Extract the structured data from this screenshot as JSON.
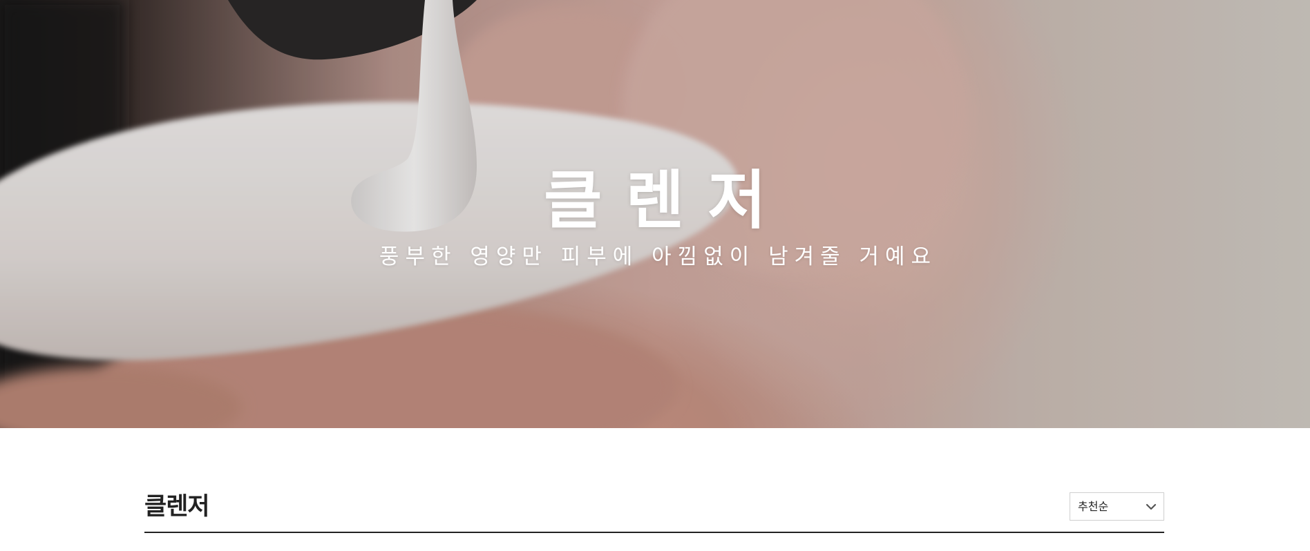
{
  "hero": {
    "title": "클렌저",
    "subtitle": "풍부한 영양만 피부에 아낌없이 남겨줄 거예요"
  },
  "category": {
    "title": "클렌저",
    "sort": {
      "selected": "추천순"
    }
  },
  "icons": {
    "sort_chevron": "chevron-down-icon"
  },
  "colors": {
    "text_dark": "#222222",
    "hero_text": "#ffffff",
    "select_border": "#cfcfcf"
  }
}
